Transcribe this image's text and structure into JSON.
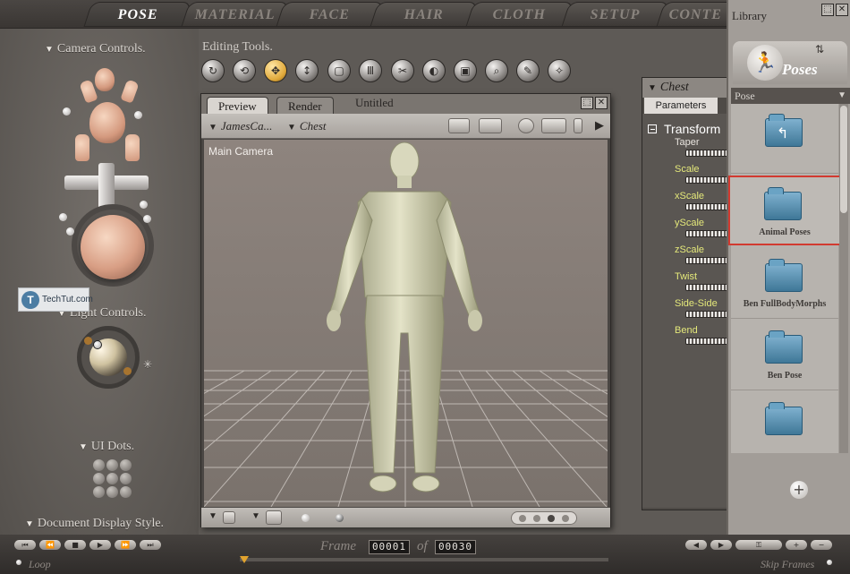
{
  "top_tabs": [
    "POSE",
    "MATERIAL",
    "FACE",
    "HAIR",
    "CLOTH",
    "SETUP",
    "CONTE"
  ],
  "active_tab": "POSE",
  "left_panel": {
    "camera_controls": "Camera Controls.",
    "light_controls": "Light Controls.",
    "ui_dots": "UI Dots.",
    "document_display_style": "Document Display Style."
  },
  "editing_tools": {
    "label": "Editing Tools.",
    "tools": [
      "rotate-icon",
      "twist-icon",
      "translate-icon",
      "translate-in-out-icon",
      "scale-icon",
      "taper-icon",
      "chain-break-icon",
      "color-icon",
      "grouping-icon",
      "view-magnifier-icon",
      "morph-brush-icon",
      "direct-manipulation-icon"
    ]
  },
  "document": {
    "tabs": [
      "Preview",
      "Render"
    ],
    "active_tab": "Preview",
    "title": "Untitled",
    "figure_selector": "JamesCa...",
    "part_selector": "Chest",
    "viewport_label": "Main Camera"
  },
  "parameters": {
    "header": "Chest",
    "tab": "Parameters",
    "group": "Transform",
    "items": [
      "Taper",
      "Scale",
      "xScale",
      "yScale",
      "zScale",
      "Twist",
      "Side-Side",
      "Bend"
    ]
  },
  "library": {
    "title": "Library",
    "category": "Poses",
    "subcategory": "Pose",
    "items": [
      "",
      "Animal Poses",
      "Ben FullBodyMorphs",
      "Ben Pose",
      ""
    ],
    "selected_index": 1
  },
  "timeline": {
    "frame_label": "Frame",
    "current_frame": "00001",
    "of_label": "of",
    "total_frames": "00030",
    "loop_label": "Loop",
    "skip_frames_label": "Skip Frames"
  },
  "watermark": {
    "text": "TechTut.com"
  },
  "colors": {
    "selection_border": "#d23a30",
    "active_tool": "#e0a93a",
    "param_label": "#e4e87a"
  }
}
